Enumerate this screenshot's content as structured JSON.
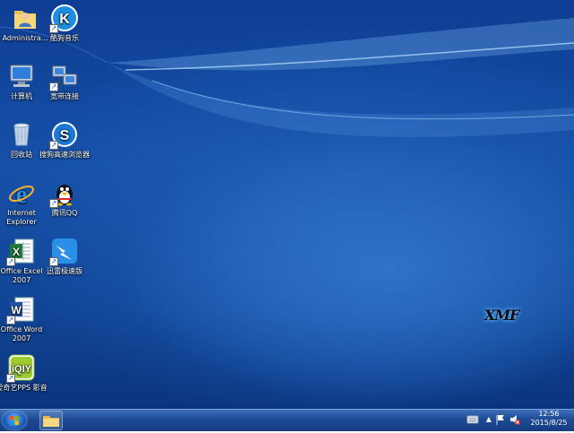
{
  "desktop_icons": [
    {
      "label": "Administra...",
      "icon": "user-folder-icon"
    },
    {
      "label": "酷狗音乐",
      "icon": "kugou-music-icon"
    },
    {
      "label": "计算机",
      "icon": "computer-icon"
    },
    {
      "label": "宽带连接",
      "icon": "network-connection-icon"
    },
    {
      "label": "回收站",
      "icon": "recycle-bin-icon"
    },
    {
      "label": "搜狗高速浏览器",
      "icon": "sogou-browser-icon"
    },
    {
      "label": "Internet Explorer",
      "icon": "internet-explorer-icon"
    },
    {
      "label": "腾讯QQ",
      "icon": "qq-penguin-icon"
    },
    {
      "label": "Office Excel 2007",
      "icon": "excel-icon"
    },
    {
      "label": "迅雷极速版",
      "icon": "xunlei-icon"
    },
    {
      "label": "Office Word 2007",
      "icon": "word-icon"
    },
    {
      "label": "爱奇艺PPS 影音",
      "icon": "iqiyi-pps-icon"
    }
  ],
  "wallpaper_logo": "XMF",
  "taskbar": {
    "start_icon": "windows-start-orb-icon",
    "pinned": [
      {
        "icon": "file-explorer-icon"
      }
    ],
    "tray": [
      "keyboard-icon",
      "show-hidden-icons-arrow-icon",
      "action-center-flag-icon",
      "volume-muted-icon"
    ],
    "time": "12:56",
    "date": "2015/8/25"
  },
  "colors": {
    "desktop": "#1650a8",
    "taskbar": "#1d4a95"
  }
}
